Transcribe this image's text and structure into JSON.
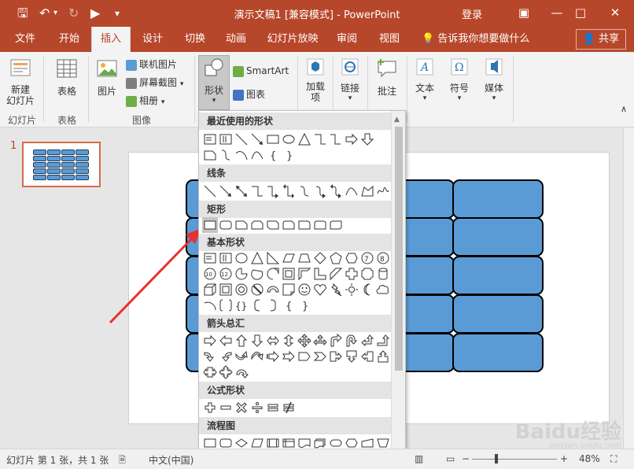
{
  "titlebar": {
    "title": "演示文稿1 [兼容模式] - PowerPoint",
    "login": "登录",
    "minimize": "—",
    "restore": "□",
    "close": "✕",
    "ribbon_display": "▣"
  },
  "tabs": [
    "文件",
    "开始",
    "插入",
    "设计",
    "切换",
    "动画",
    "幻灯片放映",
    "审阅",
    "视图"
  ],
  "tell_me": "告诉我你想要做什么",
  "share": "共享",
  "ribbon": {
    "new_slide": "新建\n幻灯片",
    "table": "表格",
    "picture": "图片",
    "online_picture": "联机图片",
    "screenshot": "屏幕截图",
    "album": "相册",
    "shapes": "形状",
    "smartart": "SmartArt",
    "chart": "图表",
    "addins": "加载\n项",
    "link": "链接",
    "comment": "批注",
    "text": "文本",
    "symbol": "符号",
    "media": "媒体",
    "groups": {
      "slides": "幻灯片",
      "tables": "表格",
      "images": "图像"
    }
  },
  "thumbnail": {
    "number": "1"
  },
  "dropdown": {
    "recent": "最近使用的形状",
    "lines": "线条",
    "rectangles": "矩形",
    "basic": "基本形状",
    "arrows": "箭头总汇",
    "equation": "公式形状",
    "flowchart": "流程图"
  },
  "status": {
    "slide_info": "幻灯片 第 1 张，共 1 张",
    "language": "中文(中国)",
    "zoom": "48%",
    "zoom_minus": "−",
    "zoom_plus": "+"
  },
  "watermark": {
    "main": "Baidu经验",
    "sub": "jingyan.baidu.com"
  },
  "colors": {
    "accent": "#b7472a",
    "shape_fill": "#5b9bd5"
  }
}
